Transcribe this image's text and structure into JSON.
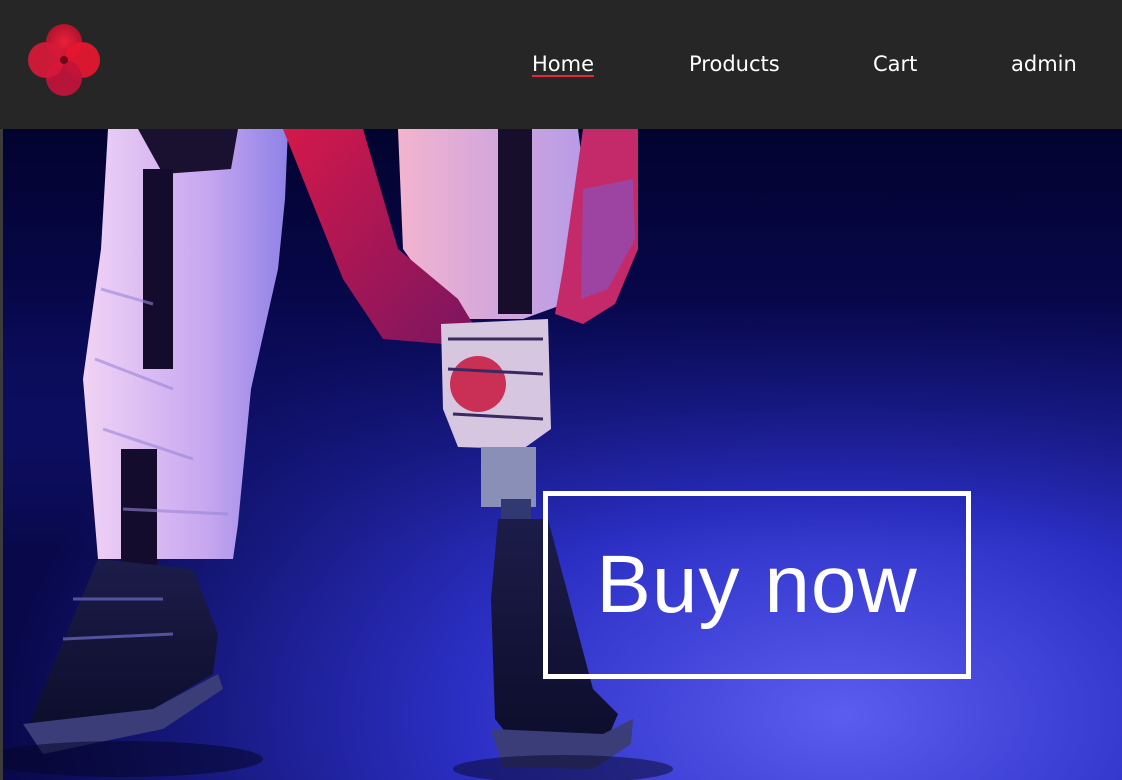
{
  "nav": {
    "logo_icon": "four-petal-flower-icon",
    "items": [
      {
        "label": "Home",
        "active": true
      },
      {
        "label": "Products",
        "active": false
      },
      {
        "label": "Cart",
        "active": false
      },
      {
        "label": "admin",
        "active": false
      }
    ]
  },
  "hero": {
    "image": "prosthetic-leg-sneakers-photo",
    "cta_label": "Buy now"
  },
  "colors": {
    "navbar_bg": "#262626",
    "accent_red": "#e3263a",
    "hero_blue": "#2a2fb8",
    "text": "#ffffff"
  }
}
